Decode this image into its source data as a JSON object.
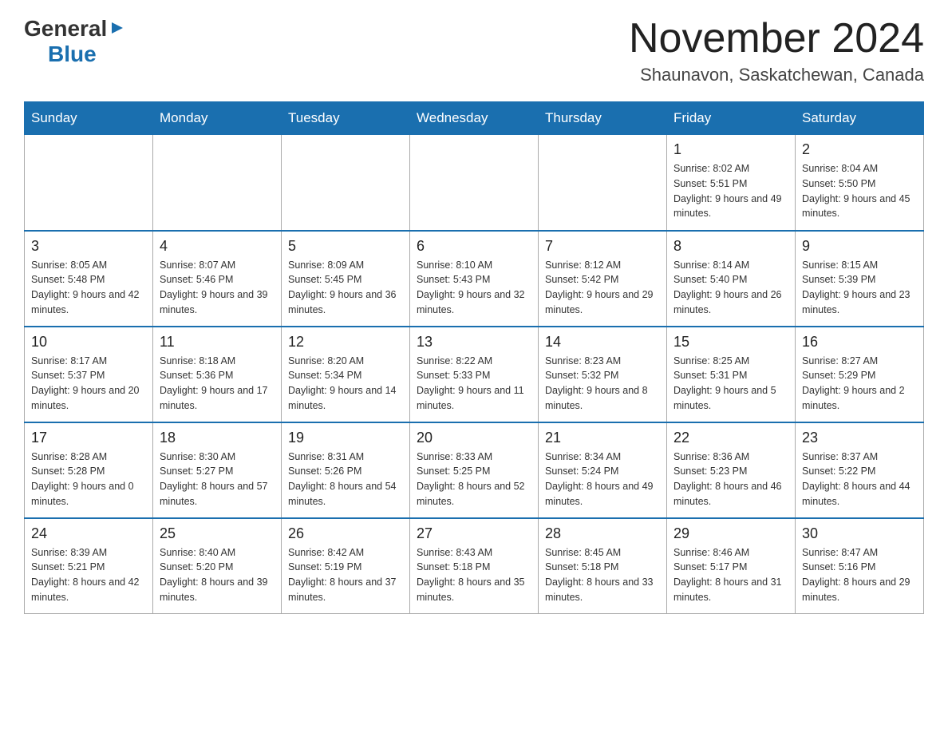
{
  "header": {
    "logo": {
      "general": "General",
      "blue": "Blue",
      "arrow_color": "#1a6faf"
    },
    "title": "November 2024",
    "location": "Shaunavon, Saskatchewan, Canada"
  },
  "calendar": {
    "days_of_week": [
      "Sunday",
      "Monday",
      "Tuesday",
      "Wednesday",
      "Thursday",
      "Friday",
      "Saturday"
    ],
    "weeks": [
      {
        "days": [
          {
            "number": "",
            "info": ""
          },
          {
            "number": "",
            "info": ""
          },
          {
            "number": "",
            "info": ""
          },
          {
            "number": "",
            "info": ""
          },
          {
            "number": "",
            "info": ""
          },
          {
            "number": "1",
            "info": "Sunrise: 8:02 AM\nSunset: 5:51 PM\nDaylight: 9 hours and 49 minutes."
          },
          {
            "number": "2",
            "info": "Sunrise: 8:04 AM\nSunset: 5:50 PM\nDaylight: 9 hours and 45 minutes."
          }
        ]
      },
      {
        "days": [
          {
            "number": "3",
            "info": "Sunrise: 8:05 AM\nSunset: 5:48 PM\nDaylight: 9 hours and 42 minutes."
          },
          {
            "number": "4",
            "info": "Sunrise: 8:07 AM\nSunset: 5:46 PM\nDaylight: 9 hours and 39 minutes."
          },
          {
            "number": "5",
            "info": "Sunrise: 8:09 AM\nSunset: 5:45 PM\nDaylight: 9 hours and 36 minutes."
          },
          {
            "number": "6",
            "info": "Sunrise: 8:10 AM\nSunset: 5:43 PM\nDaylight: 9 hours and 32 minutes."
          },
          {
            "number": "7",
            "info": "Sunrise: 8:12 AM\nSunset: 5:42 PM\nDaylight: 9 hours and 29 minutes."
          },
          {
            "number": "8",
            "info": "Sunrise: 8:14 AM\nSunset: 5:40 PM\nDaylight: 9 hours and 26 minutes."
          },
          {
            "number": "9",
            "info": "Sunrise: 8:15 AM\nSunset: 5:39 PM\nDaylight: 9 hours and 23 minutes."
          }
        ]
      },
      {
        "days": [
          {
            "number": "10",
            "info": "Sunrise: 8:17 AM\nSunset: 5:37 PM\nDaylight: 9 hours and 20 minutes."
          },
          {
            "number": "11",
            "info": "Sunrise: 8:18 AM\nSunset: 5:36 PM\nDaylight: 9 hours and 17 minutes."
          },
          {
            "number": "12",
            "info": "Sunrise: 8:20 AM\nSunset: 5:34 PM\nDaylight: 9 hours and 14 minutes."
          },
          {
            "number": "13",
            "info": "Sunrise: 8:22 AM\nSunset: 5:33 PM\nDaylight: 9 hours and 11 minutes."
          },
          {
            "number": "14",
            "info": "Sunrise: 8:23 AM\nSunset: 5:32 PM\nDaylight: 9 hours and 8 minutes."
          },
          {
            "number": "15",
            "info": "Sunrise: 8:25 AM\nSunset: 5:31 PM\nDaylight: 9 hours and 5 minutes."
          },
          {
            "number": "16",
            "info": "Sunrise: 8:27 AM\nSunset: 5:29 PM\nDaylight: 9 hours and 2 minutes."
          }
        ]
      },
      {
        "days": [
          {
            "number": "17",
            "info": "Sunrise: 8:28 AM\nSunset: 5:28 PM\nDaylight: 9 hours and 0 minutes."
          },
          {
            "number": "18",
            "info": "Sunrise: 8:30 AM\nSunset: 5:27 PM\nDaylight: 8 hours and 57 minutes."
          },
          {
            "number": "19",
            "info": "Sunrise: 8:31 AM\nSunset: 5:26 PM\nDaylight: 8 hours and 54 minutes."
          },
          {
            "number": "20",
            "info": "Sunrise: 8:33 AM\nSunset: 5:25 PM\nDaylight: 8 hours and 52 minutes."
          },
          {
            "number": "21",
            "info": "Sunrise: 8:34 AM\nSunset: 5:24 PM\nDaylight: 8 hours and 49 minutes."
          },
          {
            "number": "22",
            "info": "Sunrise: 8:36 AM\nSunset: 5:23 PM\nDaylight: 8 hours and 46 minutes."
          },
          {
            "number": "23",
            "info": "Sunrise: 8:37 AM\nSunset: 5:22 PM\nDaylight: 8 hours and 44 minutes."
          }
        ]
      },
      {
        "days": [
          {
            "number": "24",
            "info": "Sunrise: 8:39 AM\nSunset: 5:21 PM\nDaylight: 8 hours and 42 minutes."
          },
          {
            "number": "25",
            "info": "Sunrise: 8:40 AM\nSunset: 5:20 PM\nDaylight: 8 hours and 39 minutes."
          },
          {
            "number": "26",
            "info": "Sunrise: 8:42 AM\nSunset: 5:19 PM\nDaylight: 8 hours and 37 minutes."
          },
          {
            "number": "27",
            "info": "Sunrise: 8:43 AM\nSunset: 5:18 PM\nDaylight: 8 hours and 35 minutes."
          },
          {
            "number": "28",
            "info": "Sunrise: 8:45 AM\nSunset: 5:18 PM\nDaylight: 8 hours and 33 minutes."
          },
          {
            "number": "29",
            "info": "Sunrise: 8:46 AM\nSunset: 5:17 PM\nDaylight: 8 hours and 31 minutes."
          },
          {
            "number": "30",
            "info": "Sunrise: 8:47 AM\nSunset: 5:16 PM\nDaylight: 8 hours and 29 minutes."
          }
        ]
      }
    ]
  }
}
